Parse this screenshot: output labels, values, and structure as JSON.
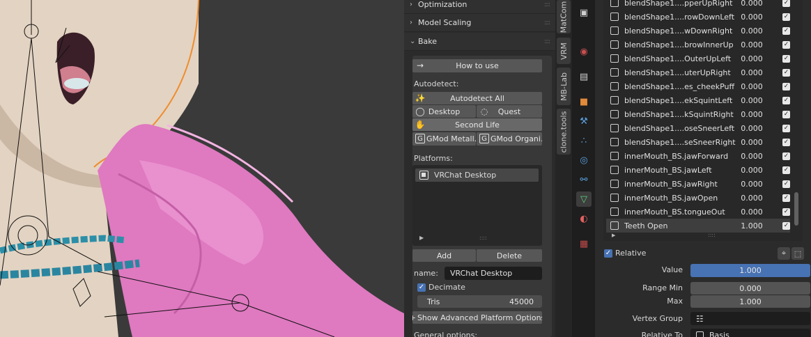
{
  "cats": {
    "sections": [
      {
        "label": "Optimization"
      },
      {
        "label": "Model Scaling"
      },
      {
        "label": "Bake"
      }
    ],
    "how_to_use": "How to use",
    "autodetect_label": "Autodetect:",
    "autodetect_all": "Autodetect All",
    "desktop": "Desktop",
    "quest": "Quest",
    "second_life": "Second Life",
    "gmod_metal": "GMod Metall...",
    "gmod_organic": "GMod Organi...",
    "platforms_label": "Platforms:",
    "platform_items": [
      "VRChat Desktop"
    ],
    "add": "Add",
    "delete": "Delete",
    "name_label": "name:",
    "name_value": "VRChat Desktop",
    "decimate": "Decimate",
    "tris_label": "Tris",
    "tris_value": "45000",
    "show_advanced": "Show Advanced Platform Options",
    "general_options": "General options:"
  },
  "vtabs": [
    "MatCom",
    "VRM",
    "MB-Lab",
    "clone.tools"
  ],
  "property_icons": [
    "render-icon",
    "output-icon",
    "view-layer-icon",
    "scene-icon",
    "world-icon",
    "collection-icon",
    "object-icon",
    "modifier-icon",
    "particles-icon",
    "physics-icon",
    "constraints-icon",
    "object-data-icon",
    "material-icon",
    "texture-icon"
  ],
  "shape_keys": [
    {
      "name": "blendShape1....pperUpRight",
      "value": "0.000",
      "checked": true
    },
    {
      "name": "blendShape1....rowDownLeft",
      "value": "0.000",
      "checked": true
    },
    {
      "name": "blendShape1....wDownRight",
      "value": "0.000",
      "checked": true
    },
    {
      "name": "blendShape1....browInnerUp",
      "value": "0.000",
      "checked": true
    },
    {
      "name": "blendShape1....OuterUpLeft",
      "value": "0.000",
      "checked": true
    },
    {
      "name": "blendShape1....uterUpRight",
      "value": "0.000",
      "checked": true
    },
    {
      "name": "blendShape1....es_cheekPuff",
      "value": "0.000",
      "checked": true
    },
    {
      "name": "blendShape1....ekSquintLeft",
      "value": "0.000",
      "checked": true
    },
    {
      "name": "blendShape1....kSquintRight",
      "value": "0.000",
      "checked": true
    },
    {
      "name": "blendShape1....oseSneerLeft",
      "value": "0.000",
      "checked": true
    },
    {
      "name": "blendShape1....seSneerRight",
      "value": "0.000",
      "checked": true
    },
    {
      "name": "innerMouth_BS.jawForward",
      "value": "0.000",
      "checked": true
    },
    {
      "name": "innerMouth_BS.jawLeft",
      "value": "0.000",
      "checked": true
    },
    {
      "name": "innerMouth_BS.jawRight",
      "value": "0.000",
      "checked": true
    },
    {
      "name": "innerMouth_BS.jawOpen",
      "value": "0.000",
      "checked": true
    },
    {
      "name": "innerMouth_BS.tongueOut",
      "value": "0.000",
      "checked": true
    },
    {
      "name": "Teeth Open",
      "value": "1.000",
      "checked": true,
      "selected": true
    }
  ],
  "relative_label": "Relative",
  "value_label": "Value",
  "value_value": "1.000",
  "range_min_label": "Range Min",
  "range_min_value": "0.000",
  "max_label": "Max",
  "max_value": "1.000",
  "vertex_group_label": "Vertex Group",
  "relative_to_label": "Relative To",
  "relative_to_value": "Basis",
  "colors": {
    "accent": "#4772b3",
    "pink": "#e07bc2",
    "skin": "#e8d6c4",
    "chain": "#2c8fa8"
  }
}
